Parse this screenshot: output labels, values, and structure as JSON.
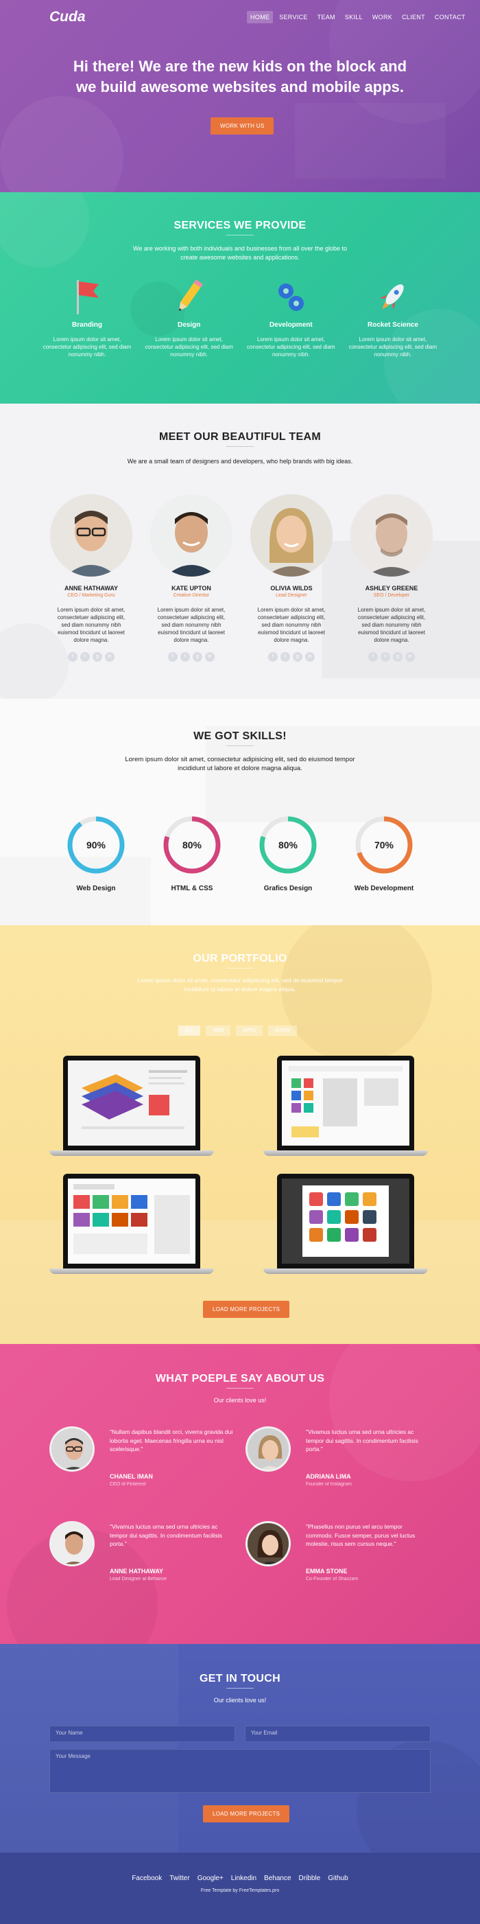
{
  "brand": "Cuda",
  "nav": [
    "HOME",
    "SERVICE",
    "TEAM",
    "SKILL",
    "WORK",
    "CLIENT",
    "CONTACT"
  ],
  "hero": {
    "line1": "Hi there! We are the new kids on the block and",
    "line2": "we build awesome websites and mobile apps.",
    "cta": "WORK WITH US"
  },
  "services": {
    "title": "SERVICES WE PROVIDE",
    "subtitle_line1": "We are working with both individuals and businesses from all over the globe to",
    "subtitle_line2": "create awesome websites and applications.",
    "items": [
      {
        "icon": "flag-icon",
        "title": "Branding",
        "text": "Lorem ipsum dolor sit amet, consectetur adipiscing elit, sed diam nonummy nibh."
      },
      {
        "icon": "pencil-icon",
        "title": "Design",
        "text": "Lorem ipsum dolor sit amet, consectetur adipiscing elit, sed diam nonummy nibh."
      },
      {
        "icon": "gears-icon",
        "title": "Development",
        "text": "Lorem ipsum dolor sit amet, consectetur adipiscing elit, sed diam nonummy nibh."
      },
      {
        "icon": "rocket-icon",
        "title": "Rocket Science",
        "text": "Lorem ipsum dolor sit amet, consectetur adipiscing elit, sed diam nonummy nibh."
      }
    ]
  },
  "team": {
    "title": "MEET OUR BEAUTIFUL TEAM",
    "subtitle": "We are a small team of designers and developers, who help brands with big ideas.",
    "members": [
      {
        "name": "ANNE HATHAWAY",
        "role": "CEO / Marketing Guru",
        "text": "Lorem ipsum dolor sit amet, consectetuer adipiscing elit, sed diam nonummy nibh euismod tincidunt ut laoreet dolore magna."
      },
      {
        "name": "KATE UPTON",
        "role": "Creative Director",
        "text": "Lorem ipsum dolor sit amet, consectetuer adipiscing elit, sed diam nonummy nibh euismod tincidunt ut laoreet dolore magna."
      },
      {
        "name": "OLIVIA WILDS",
        "role": "Lead Designer",
        "text": "Lorem ipsum dolor sit amet, consectetuer adipiscing elit, sed diam nonummy nibh euismod tincidunt ut laoreet dolore magna."
      },
      {
        "name": "ASHLEY GREENE",
        "role": "SEO / Developer",
        "text": "Lorem ipsum dolor sit amet, consectetuer adipiscing elit, sed diam nonummy nibh euismod tincidunt ut laoreet dolore magna."
      }
    ]
  },
  "skills": {
    "title": "WE GOT SKILLS!",
    "subtitle_line1": "Lorem ipsum dolor sit amet, consectetur adipisicing elit, sed do eiusmod tempor",
    "subtitle_line2": "incididunt ut labore et dolore magna aliqua.",
    "items": [
      {
        "label": "Web Design",
        "value": "90%",
        "percent": 90,
        "color": "#3db8e0"
      },
      {
        "label": "HTML & CSS",
        "value": "80%",
        "percent": 80,
        "color": "#d2437c"
      },
      {
        "label": "Grafics Design",
        "value": "80%",
        "percent": 80,
        "color": "#36c79a"
      },
      {
        "label": "Web Development",
        "value": "70%",
        "percent": 70,
        "color": "#ea7a3c"
      }
    ]
  },
  "portfolio": {
    "title": "OUR PORTFOLIO",
    "subtitle_line1": "Lorem ipsum dolor sit amet, consectetur adipisicing elit, sed do eiusmod tempor",
    "subtitle_line2": "incididunt ut labore et dolore magna aliqua.",
    "filters": [
      "ALL",
      "WEB",
      "APPS",
      "ICONS"
    ],
    "load_more": "LOAD MORE PROJECTS"
  },
  "testimonials": {
    "title": "WHAT POEPLE SAY ABOUT US",
    "subtitle": "Our clients love us!",
    "items": [
      {
        "quote": "\"Nullam dapibus blandit orci, viverra gravida dui lobortis eget. Maecenas fringilla urna eu nisl scelerisque.\"",
        "name": "CHANEL IMAN",
        "position": "CEO of Pinterest"
      },
      {
        "quote": "\"Vivamus luctus urna sed urna ultricies ac tempor dui sagittis. In condimentum facilisis porta.\"",
        "name": "ADRIANA LIMA",
        "position": "Founder of Instagram"
      },
      {
        "quote": "\"Vivamus luctus urna sed urna ultricies ac tempor dui sagittis. In condimentum facilisis porta.\"",
        "name": "ANNE HATHAWAY",
        "position": "Lead Designer at Behance"
      },
      {
        "quote": "\"Phasellus non purus vel arcu tempor commodo. Fusce semper, purus vel luctus molestie, risus sem cursus neque.\"",
        "name": "EMMA STONE",
        "position": "Co-Founder of Shazzam"
      }
    ]
  },
  "contact": {
    "title": "GET IN TOUCH",
    "subtitle": "Our clients love us!",
    "name_placeholder": "Your Name",
    "email_placeholder": "Your Email",
    "message_placeholder": "Your Message",
    "submit": "LOAD MORE PROJECTS"
  },
  "footer": {
    "links": [
      "Facebook",
      "Twitter",
      "Google+",
      "Linkedin",
      "Behance",
      "Dribble",
      "Github"
    ],
    "credit": "Free Template by FreeTemplates.pro"
  }
}
